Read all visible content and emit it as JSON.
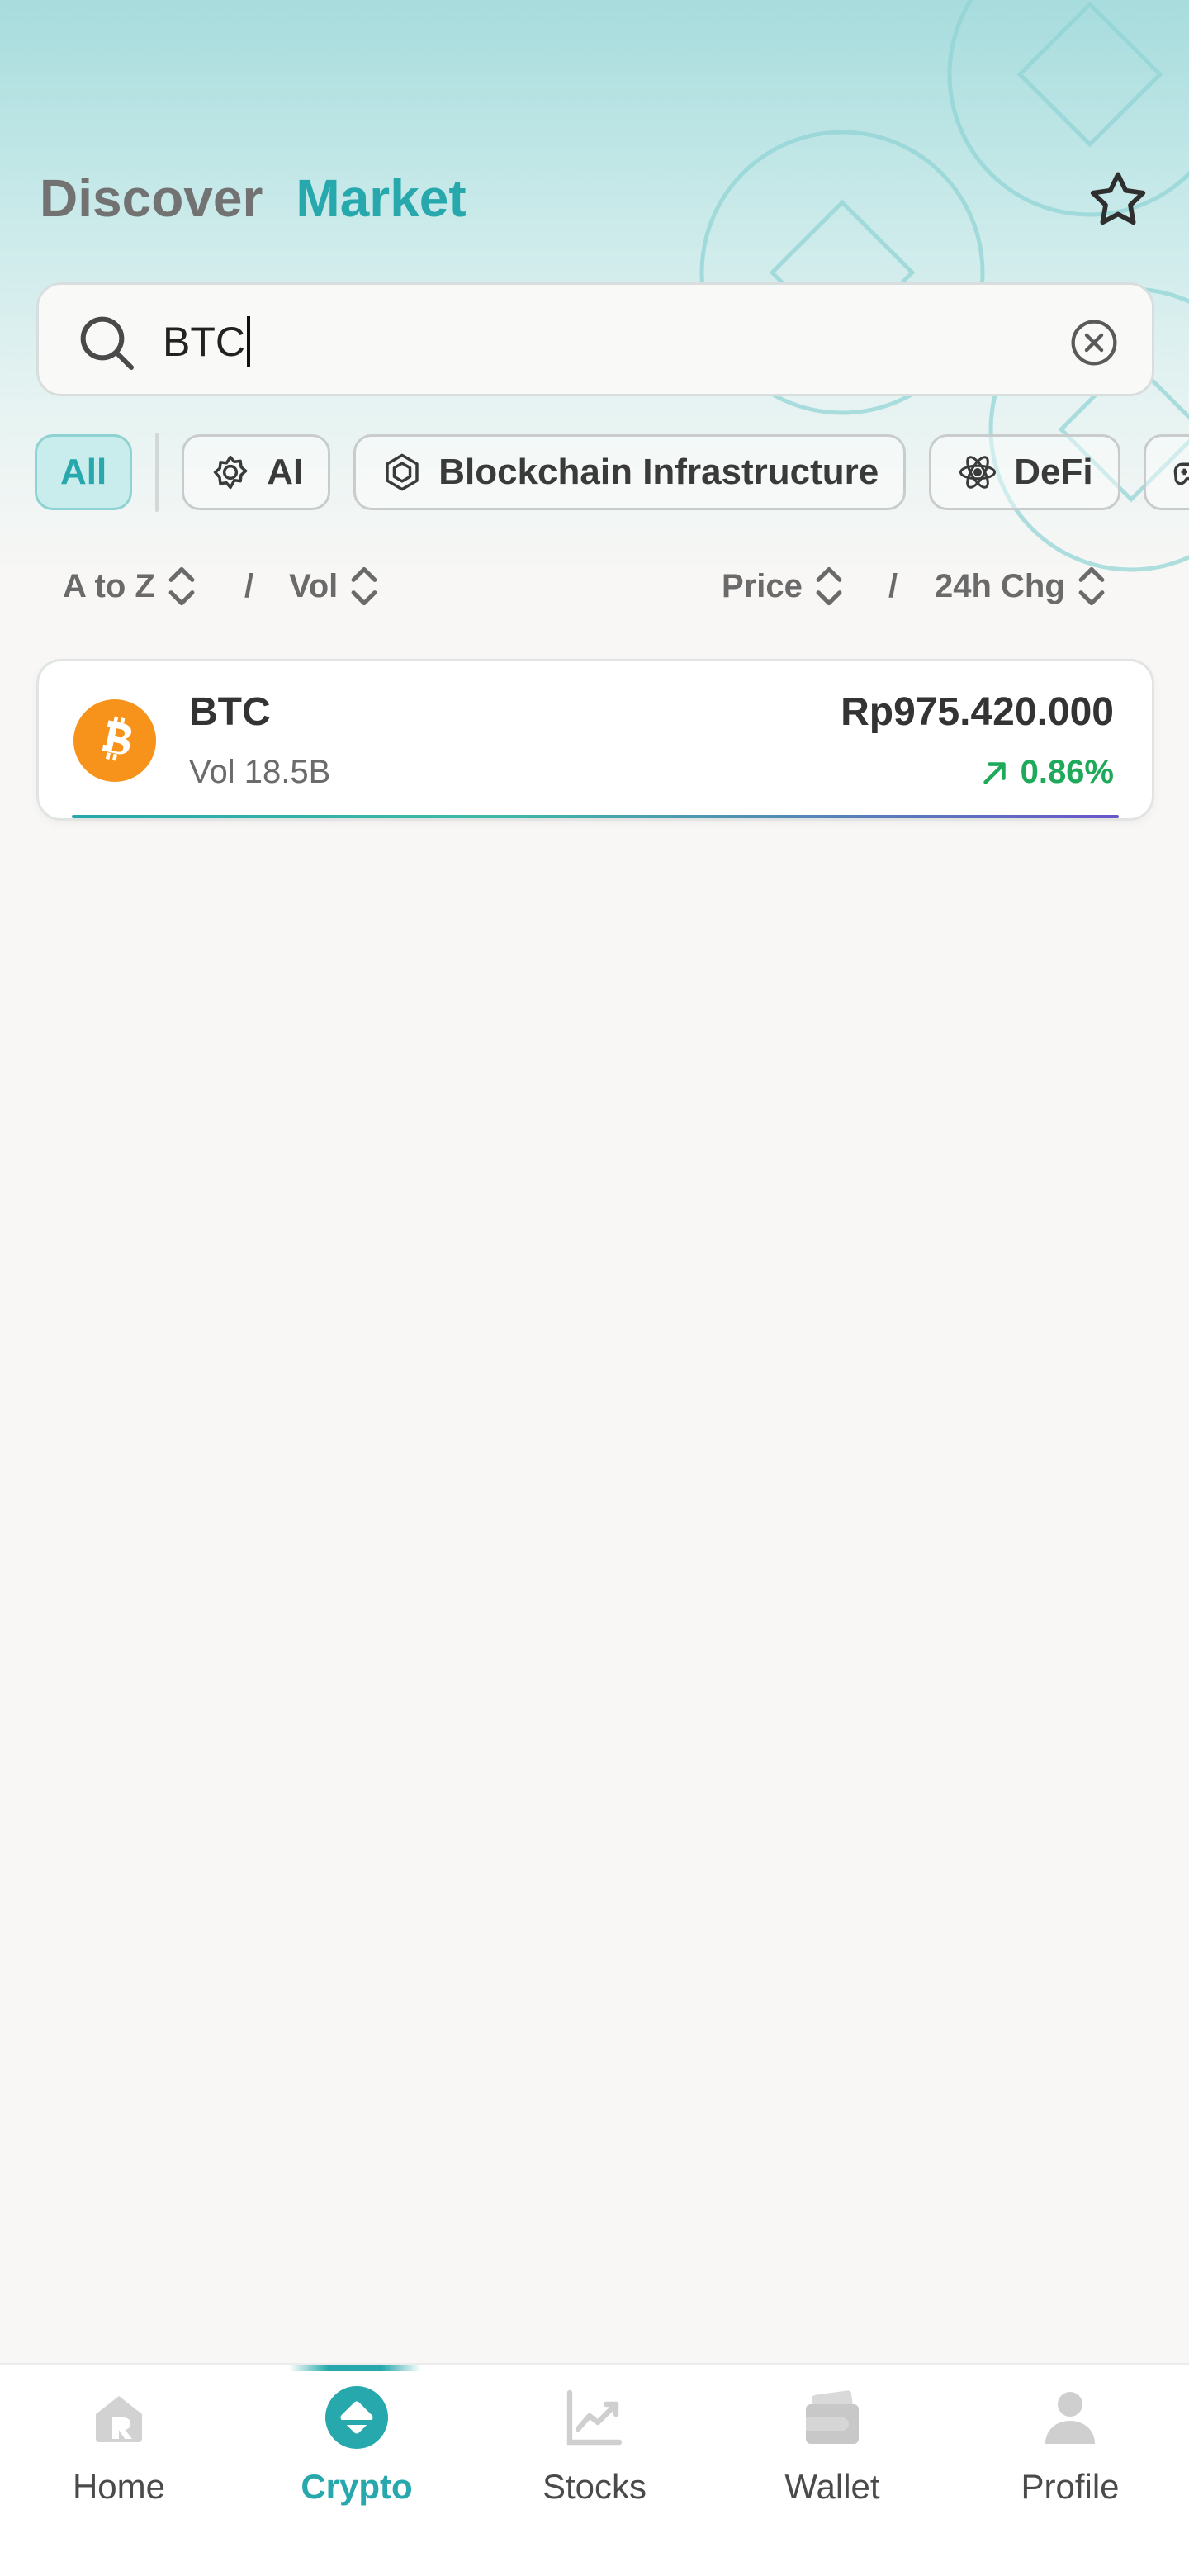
{
  "header": {
    "tabs": [
      {
        "label": "Discover",
        "active": false
      },
      {
        "label": "Market",
        "active": true
      }
    ],
    "favorites_icon": "star-outline-icon"
  },
  "search": {
    "value": "BTC",
    "placeholder": "",
    "search_icon": "search-icon",
    "clear_icon": "clear-circle-icon"
  },
  "filters": {
    "chips": [
      {
        "label": "All",
        "active": true,
        "icon": ""
      },
      {
        "label": "AI",
        "active": false,
        "icon": "ai-chip-icon"
      },
      {
        "label": "Blockchain Infrastructure",
        "active": false,
        "icon": "cube-icon"
      },
      {
        "label": "DeFi",
        "active": false,
        "icon": "atom-icon"
      },
      {
        "label": "",
        "active": false,
        "icon": "gamepad-icon"
      }
    ]
  },
  "sort": {
    "name": "A to Z",
    "volume": "Vol",
    "price": "Price",
    "change": "24h Chg",
    "separator": "/"
  },
  "results": [
    {
      "symbol": "BTC",
      "volume": "Vol 18.5B",
      "price": "Rp975.420.000",
      "change": "0.86%",
      "change_direction": "up",
      "logo_color": "#f7931a"
    }
  ],
  "bottom_nav": {
    "items": [
      {
        "label": "Home",
        "icon": "home-icon",
        "active": false
      },
      {
        "label": "Crypto",
        "icon": "crypto-icon",
        "active": true
      },
      {
        "label": "Stocks",
        "icon": "stocks-chart-icon",
        "active": false
      },
      {
        "label": "Wallet",
        "icon": "wallet-icon",
        "active": false
      },
      {
        "label": "Profile",
        "icon": "profile-icon",
        "active": false
      }
    ]
  },
  "colors": {
    "accent": "#26a8ac",
    "positive": "#1eaa5a",
    "background": "#f8f7f5"
  }
}
